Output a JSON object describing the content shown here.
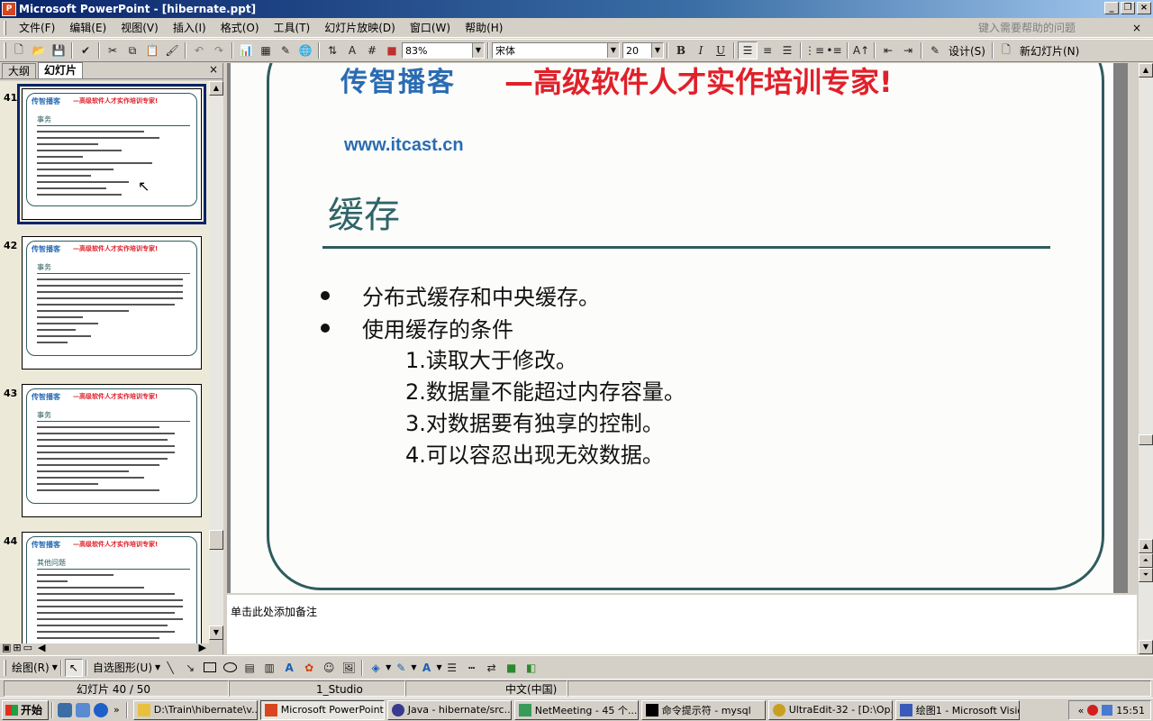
{
  "window": {
    "title": "Microsoft PowerPoint - [hibernate.ppt]",
    "app_icon_label": "P"
  },
  "menu": {
    "items": [
      "文件(F)",
      "编辑(E)",
      "视图(V)",
      "插入(I)",
      "格式(O)",
      "工具(T)",
      "幻灯片放映(D)",
      "窗口(W)",
      "帮助(H)"
    ],
    "help_placeholder": "键入需要帮助的问题",
    "close_glyph": "×"
  },
  "toolbar": {
    "zoom": "83%",
    "font_name": "宋体",
    "font_size": "20",
    "bold": "B",
    "italic": "I",
    "underline": "U",
    "design_label": "设计(S)",
    "new_slide_label": "新幻灯片(N)"
  },
  "left_pane": {
    "tabs": [
      "大纲",
      "幻灯片"
    ],
    "close_glyph": "×",
    "slides": [
      {
        "number": "41",
        "heading": "事务",
        "logo": "传智播客",
        "slogan": "—高级软件人才实作培训专家!",
        "selected": true
      },
      {
        "number": "42",
        "heading": "事务",
        "logo": "传智播客",
        "slogan": "—高级软件人才实作培训专家!",
        "selected": false
      },
      {
        "number": "43",
        "heading": "事务",
        "logo": "传智播客",
        "slogan": "—高级软件人才实作培训专家!",
        "selected": false
      },
      {
        "number": "44",
        "heading": "其他问题",
        "logo": "传智播客",
        "slogan": "—高级软件人才实作培训专家!",
        "selected": false
      }
    ]
  },
  "slide": {
    "logo_cn": "传智播客",
    "logo_url": "www.itcast.cn",
    "slogan": "—高级软件人才实作培训专家!",
    "title": "缓存",
    "bullets": [
      "分布式缓存和中央缓存。",
      "使用缓存的条件"
    ],
    "sub_items": [
      "1.读取大于修改。",
      "2.数据量不能超过内存容量。",
      "3.对数据要有独享的控制。",
      "4.可以容忍出现无效数据。"
    ]
  },
  "notes": {
    "placeholder": "单击此处添加备注"
  },
  "drawing_toolbar": {
    "draw_label": "绘图(R)",
    "autoshapes_label": "自选图形(U)"
  },
  "status": {
    "slide_position": "幻灯片 40 / 50",
    "design_template": "1_Studio",
    "language": "中文(中国)"
  },
  "taskbar": {
    "start_label": "开始",
    "tasks": [
      {
        "label": "D:\\Train\\hibernate\\v...",
        "active": false
      },
      {
        "label": "Microsoft PowerPoint",
        "active": true
      },
      {
        "label": "Java - hibernate/src...",
        "active": false
      },
      {
        "label": "NetMeeting - 45 个...",
        "active": false
      },
      {
        "label": "命令提示符 - mysql",
        "active": false
      },
      {
        "label": "UltraEdit-32 - [D:\\Op...",
        "active": false
      },
      {
        "label": "绘图1 - Microsoft Visio",
        "active": false
      }
    ],
    "tray_chevron": "«",
    "clock": "15:51"
  },
  "colors": {
    "title_bar": "#0a246a",
    "slide_accent": "#2f5c5e",
    "logo_blue": "#2a6cb3",
    "slogan_red": "#e0202a"
  }
}
